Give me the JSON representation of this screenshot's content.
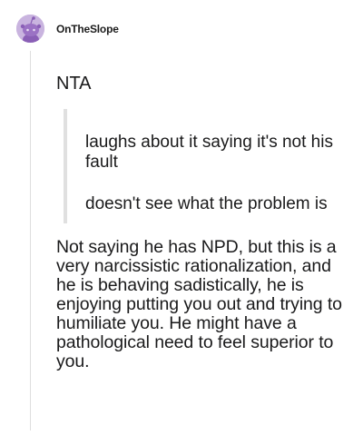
{
  "post": {
    "username": "OnTheSlope",
    "avatar": {
      "icon": "reddit-snoo-avatar-icon",
      "background_color": "#c9b4df",
      "figure_color": "#8a5fb6"
    },
    "verdict": "NTA",
    "quotes": [
      {
        "text": "laughs about it saying it's not his fault"
      },
      {
        "text": "doesn't see what the problem is"
      }
    ],
    "body": "Not saying he has NPD, but this is a very narcissistic rationalization, and he is behaving sadistically, he is enjoying putting you out and trying to humiliate you. He might have a pathological need to feel superior to you."
  }
}
